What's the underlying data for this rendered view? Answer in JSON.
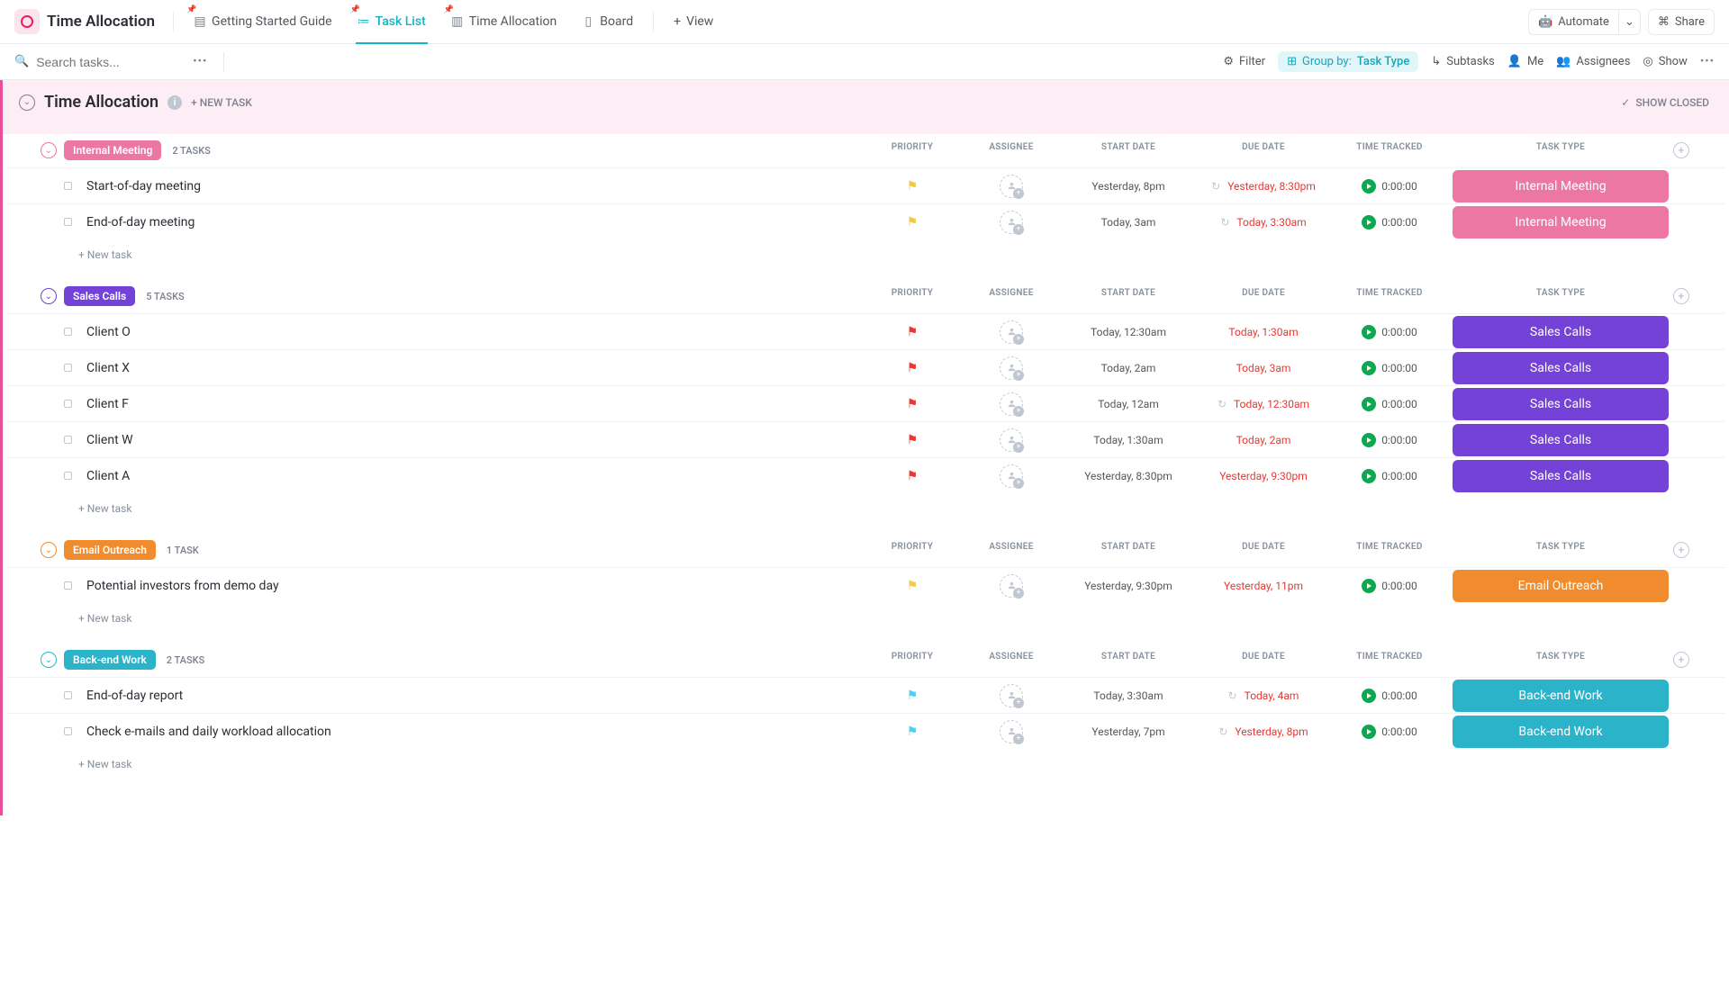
{
  "header": {
    "title": "Time Allocation",
    "tabs": [
      {
        "label": "Getting Started Guide",
        "pinned": true
      },
      {
        "label": "Task List",
        "pinned": true,
        "active": true
      },
      {
        "label": "Time Allocation",
        "pinned": true
      },
      {
        "label": "Board",
        "pinned": false
      }
    ],
    "add_view": "View",
    "automate": "Automate",
    "share": "Share"
  },
  "toolbar": {
    "search_placeholder": "Search tasks...",
    "filter": "Filter",
    "group_by_label": "Group by:",
    "group_by_value": "Task Type",
    "subtasks": "Subtasks",
    "me": "Me",
    "assignees": "Assignees",
    "show": "Show"
  },
  "section": {
    "title": "Time Allocation",
    "new_task": "+ NEW TASK",
    "show_closed": "SHOW CLOSED"
  },
  "columns": {
    "priority": "PRIORITY",
    "assignee": "ASSIGNEE",
    "start": "START DATE",
    "due": "DUE DATE",
    "time": "TIME TRACKED",
    "type": "TASK TYPE"
  },
  "colors": {
    "internal_meeting": "#ec77a3",
    "internal_meeting_chev": "#ec77a3",
    "sales_calls": "#7442d6",
    "sales_calls_chev": "#7442d6",
    "email_outreach": "#f08c2e",
    "email_outreach_chev": "#f08c2e",
    "backend_work": "#2bb3c9",
    "backend_work_chev": "#2bb3c9",
    "flag_yellow": "#f2c94c",
    "flag_red": "#e53935",
    "flag_blue": "#56ccf2"
  },
  "groups": [
    {
      "key": "internal_meeting",
      "label": "Internal Meeting",
      "count": "2 TASKS",
      "tasks": [
        {
          "name": "Start-of-day meeting",
          "flag": "yellow",
          "start": "Yesterday, 8pm",
          "due": "Yesterday, 8:30pm",
          "recur": true,
          "time": "0:00:00",
          "type": "Internal Meeting"
        },
        {
          "name": "End-of-day meeting",
          "flag": "yellow",
          "start": "Today, 3am",
          "due": "Today, 3:30am",
          "recur": true,
          "time": "0:00:00",
          "type": "Internal Meeting"
        }
      ]
    },
    {
      "key": "sales_calls",
      "label": "Sales Calls",
      "count": "5 TASKS",
      "tasks": [
        {
          "name": "Client O",
          "flag": "red",
          "start": "Today, 12:30am",
          "due": "Today, 1:30am",
          "recur": false,
          "time": "0:00:00",
          "type": "Sales Calls"
        },
        {
          "name": "Client X",
          "flag": "red",
          "start": "Today, 2am",
          "due": "Today, 3am",
          "recur": false,
          "time": "0:00:00",
          "type": "Sales Calls"
        },
        {
          "name": "Client F",
          "flag": "red",
          "start": "Today, 12am",
          "due": "Today, 12:30am",
          "recur": true,
          "time": "0:00:00",
          "type": "Sales Calls"
        },
        {
          "name": "Client W",
          "flag": "red",
          "start": "Today, 1:30am",
          "due": "Today, 2am",
          "recur": false,
          "time": "0:00:00",
          "type": "Sales Calls"
        },
        {
          "name": "Client A",
          "flag": "red",
          "start": "Yesterday, 8:30pm",
          "due": "Yesterday, 9:30pm",
          "recur": false,
          "time": "0:00:00",
          "type": "Sales Calls"
        }
      ]
    },
    {
      "key": "email_outreach",
      "label": "Email Outreach",
      "count": "1 TASK",
      "tasks": [
        {
          "name": "Potential investors from demo day",
          "flag": "yellow",
          "start": "Yesterday, 9:30pm",
          "due": "Yesterday, 11pm",
          "recur": false,
          "time": "0:00:00",
          "type": "Email Outreach"
        }
      ]
    },
    {
      "key": "backend_work",
      "label": "Back-end Work",
      "count": "2 TASKS",
      "tasks": [
        {
          "name": "End-of-day report",
          "flag": "blue",
          "start": "Today, 3:30am",
          "due": "Today, 4am",
          "recur": true,
          "time": "0:00:00",
          "type": "Back-end Work"
        },
        {
          "name": "Check e-mails and daily workload allocation",
          "flag": "blue",
          "start": "Yesterday, 7pm",
          "due": "Yesterday, 8pm",
          "recur": true,
          "time": "0:00:00",
          "type": "Back-end Work"
        }
      ]
    }
  ],
  "new_task_row": "+ New task"
}
